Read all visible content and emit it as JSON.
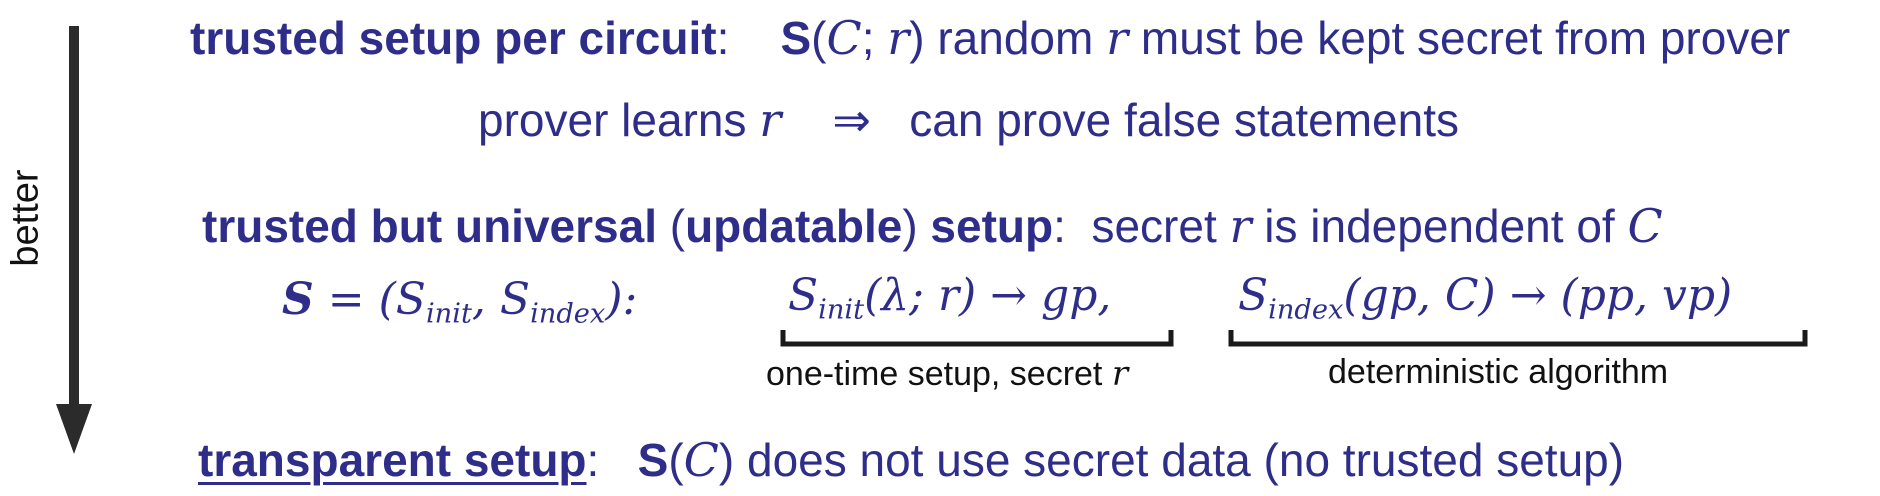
{
  "side_label": "better",
  "row1": {
    "heading": "trusted setup per circuit",
    "colon": ":",
    "S": "S",
    "open": "(",
    "C": "C",
    "semi": "; ",
    "r": "r",
    "close": ")",
    "text_random": " random ",
    "r2": "r",
    "text_rest": " must be kept secret from prover"
  },
  "row2": {
    "text_a": "prover learns ",
    "r": "r",
    "implies": "⇒",
    "text_b": "can prove false statements"
  },
  "row3": {
    "heading_a": "trusted but universal ",
    "paren_open": "(",
    "updatable": "updatable",
    "paren_close": ")",
    "heading_b": " setup",
    "colon": ":",
    "text_a": "secret ",
    "r": "r",
    "text_b": " is independent of ",
    "C": "C"
  },
  "row4": {
    "S": "S",
    "eq": " = (",
    "S1": "S",
    "sub_init": "init",
    "comma": ", ",
    "S2": "S",
    "sub_index": "index",
    "close": "):",
    "f1_S": "S",
    "f1_sub": "init",
    "f1_args": "(λ; r) → gp,",
    "f2_S": "S",
    "f2_sub": "index",
    "f2_args": "(gp, C) → (pp, vp)"
  },
  "brace1_label": "one-time setup, secret ",
  "brace1_r": "r",
  "brace2_label": "deterministic algorithm",
  "row5": {
    "heading": "transparent setup",
    "colon": ":",
    "S": "S",
    "open": "(",
    "C": "C",
    "close": ")",
    "text": " does not use secret data (no trusted setup)"
  },
  "colors": {
    "text": "#2e2e8a",
    "arrow": "#2b2b2b",
    "brace": "#1a1a1a"
  }
}
